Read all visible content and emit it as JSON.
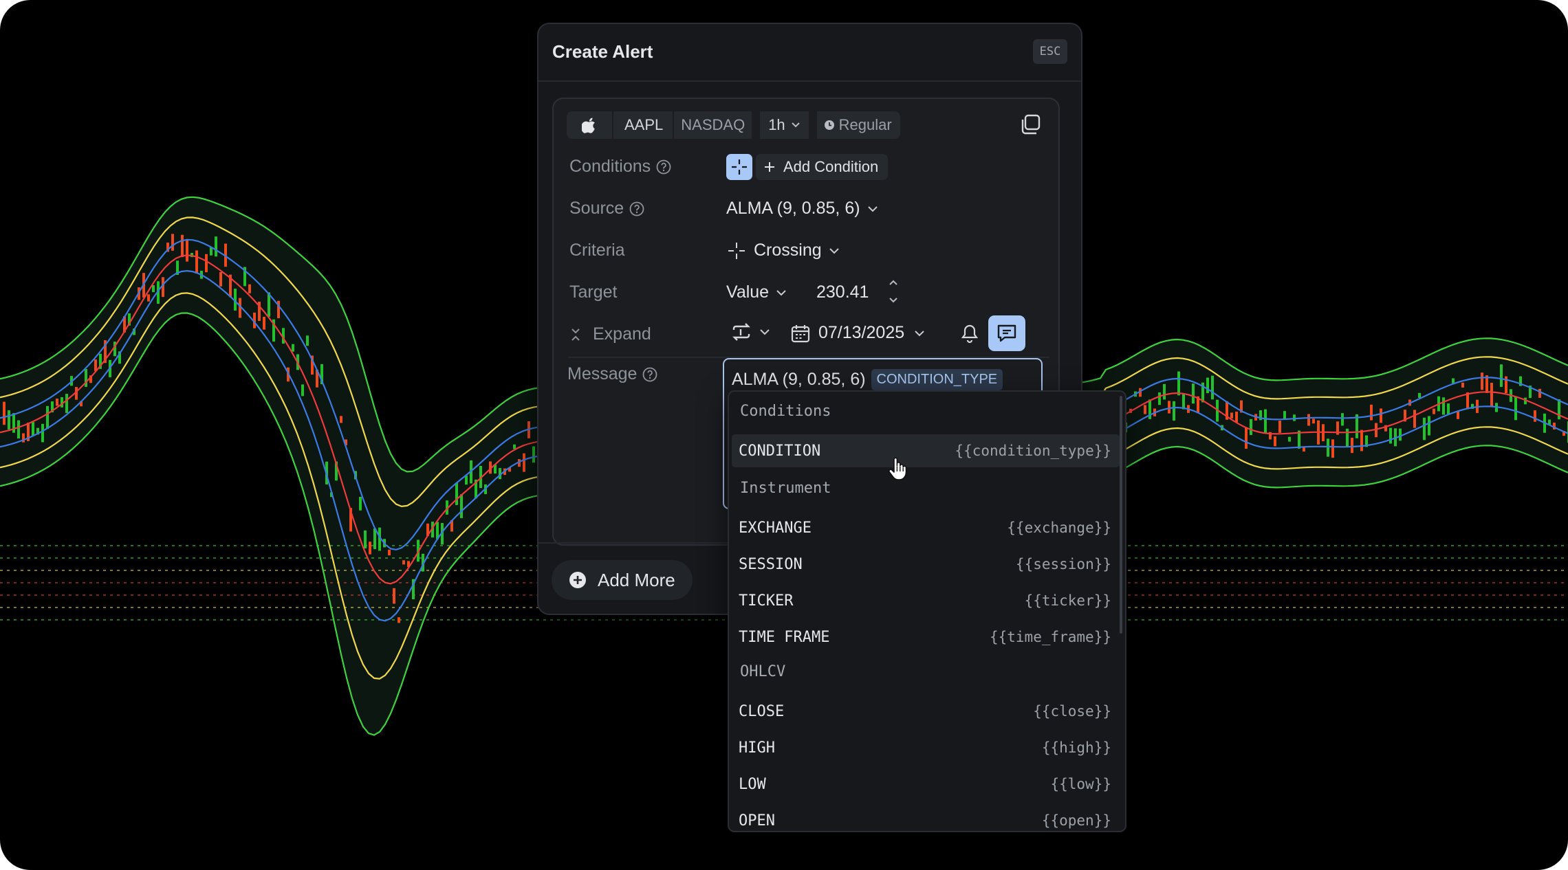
{
  "modal": {
    "title": "Create Alert",
    "esc_label": "ESC"
  },
  "instrument": {
    "logo_icon": "apple-icon",
    "ticker": "AAPL",
    "exchange": "NASDAQ",
    "timeframe": "1h",
    "session": "Regular"
  },
  "form": {
    "conditions_label": "Conditions",
    "add_condition_label": "Add Condition",
    "source_label": "Source",
    "source_value": "ALMA (9, 0.85, 6)",
    "criteria_label": "Criteria",
    "criteria_value": "Crossing",
    "target_label": "Target",
    "target_type": "Value",
    "target_value": "230.41",
    "expand_label": "Expand",
    "expiry_date": "07/13/2025",
    "message_label": "Message",
    "message_text": "ALMA (9, 0.85, 6)",
    "message_tag": "CONDITION_TYPE"
  },
  "footer": {
    "add_more_label": "Add More"
  },
  "dropdown": {
    "groups": [
      {
        "title": "Conditions",
        "items": [
          {
            "label": "CONDITION",
            "token": "{{condition_type}}",
            "highlighted": true
          }
        ]
      },
      {
        "title": "Instrument",
        "items": [
          {
            "label": "EXCHANGE",
            "token": "{{exchange}}"
          },
          {
            "label": "SESSION",
            "token": "{{session}}"
          },
          {
            "label": "TICKER",
            "token": "{{ticker}}"
          },
          {
            "label": "TIME FRAME",
            "token": "{{time_frame}}"
          }
        ]
      },
      {
        "title": "OHLCV",
        "items": [
          {
            "label": "CLOSE",
            "token": "{{close}}"
          },
          {
            "label": "HIGH",
            "token": "{{high}}"
          },
          {
            "label": "LOW",
            "token": "{{low}}"
          },
          {
            "label": "OPEN",
            "token": "{{open}}"
          }
        ]
      }
    ]
  },
  "colors": {
    "accent": "#a8c8f8",
    "candle_up": "#22c02a",
    "candle_down": "#f04a1c",
    "band_outer": "#3fd23f",
    "band_yellow": "#f0d84a",
    "band_red": "#ef3b3b",
    "band_blue": "#3a7be6"
  }
}
